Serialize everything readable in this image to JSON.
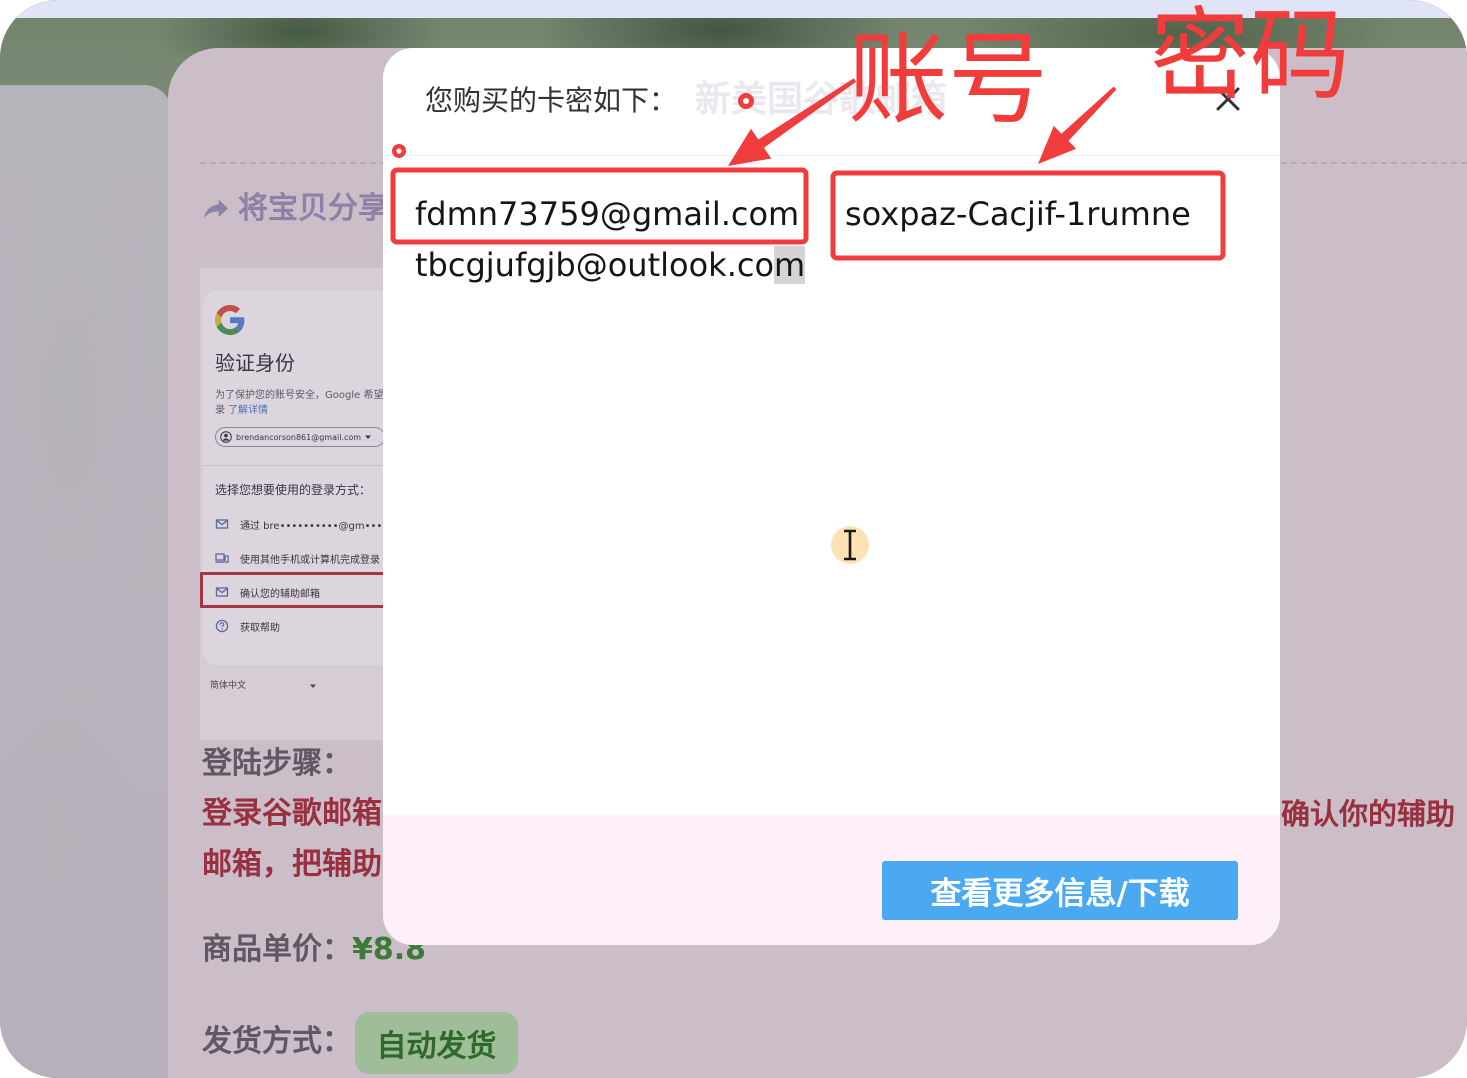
{
  "page": {
    "share_label": "将宝贝分享",
    "steps_title": "登陆步骤：",
    "steps_line1": "登录谷歌邮箱",
    "steps_line2": "邮箱，把辅助",
    "steps_right": "确认你的辅助",
    "price_label": "商品单价：",
    "price_value": "¥8.8",
    "delivery_label": "发货方式：",
    "delivery_badge": "自动发货"
  },
  "preview": {
    "title": "验证身份",
    "desc1": "为了保护您的账号安全，Google 希望",
    "desc2_prefix": "录",
    "desc2_link": "了解详情",
    "account": "brendancorson861@gmail.com",
    "choose": "选择您想要使用的登录方式：",
    "options": [
      {
        "icon": "mail-icon",
        "label": "通过 bre••••••••••@gm•••••.com"
      },
      {
        "icon": "devices-icon",
        "label": "使用其他手机或计算机完成登录"
      },
      {
        "icon": "mail-icon",
        "label": "确认您的辅助邮箱"
      },
      {
        "icon": "help-icon",
        "label": "获取帮助"
      }
    ],
    "language": "简体中文"
  },
  "modal": {
    "title": "您购买的卡密如下：",
    "product_name": "新美国谷歌邮箱",
    "account": "fdmn73759@gmail.com",
    "password": "soxpaz-Cacjif-1rumne",
    "recovery_email": "tbcgjufgjb@outlook.com",
    "more_button": "查看更多信息/下载"
  },
  "annotations": {
    "account_label": "账号",
    "password_label": "密码"
  },
  "icons": {
    "share": "share-icon",
    "close": "close-icon",
    "logo": "google-logo-icon",
    "cursor": "text-cursor-icon"
  },
  "colors": {
    "annotation_red": "#f23c3c",
    "button_blue": "#4ba9f2",
    "price_green": "#3c7a37",
    "badge_green": "#9fbd99",
    "steps_red": "#98303f"
  }
}
